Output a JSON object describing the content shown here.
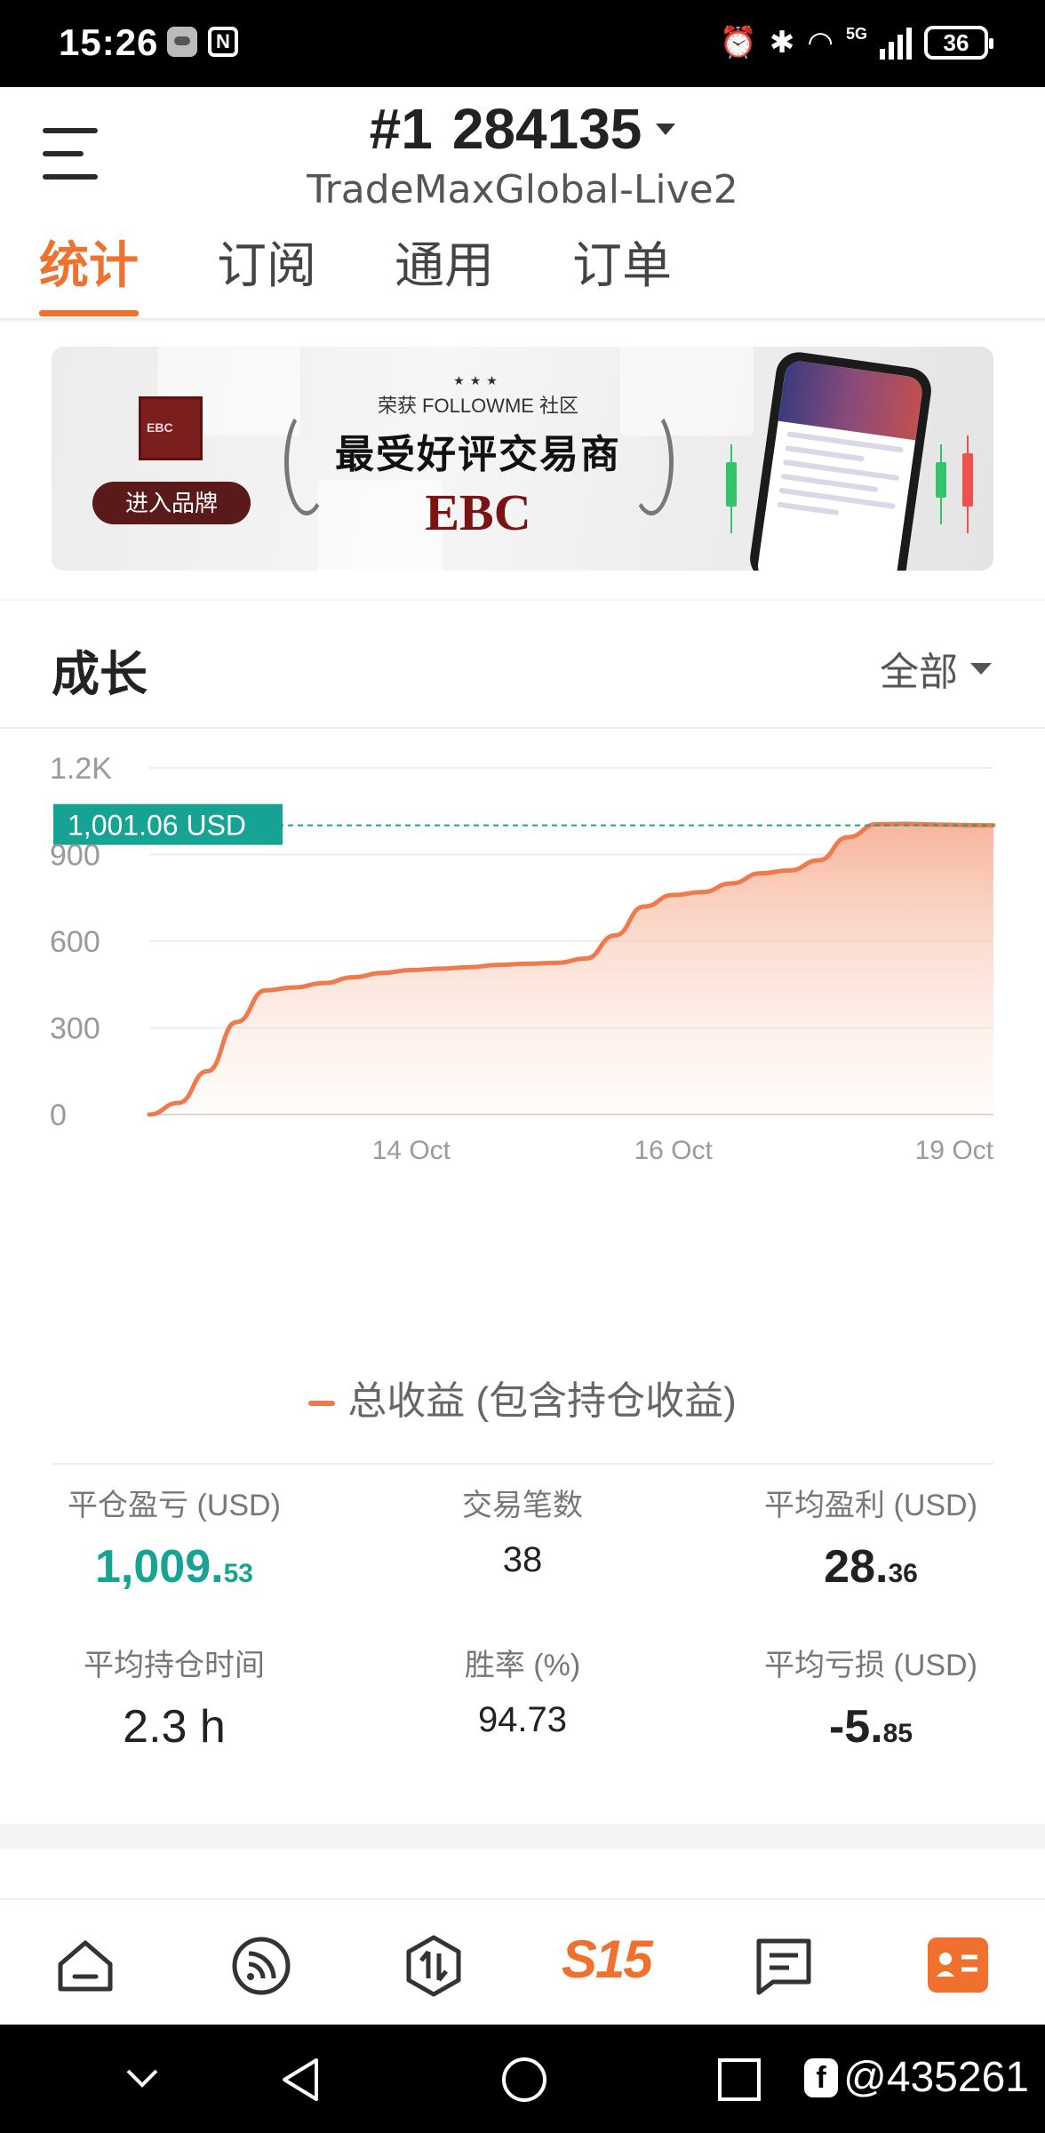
{
  "status_bar": {
    "time": "15:26",
    "network": "5G",
    "battery": "36"
  },
  "header": {
    "account_prefix": "#1",
    "account_number": "284135",
    "server": "TradeMaxGlobal-Live2"
  },
  "tabs": [
    {
      "label": "统计",
      "active": true
    },
    {
      "label": "订阅",
      "active": false
    },
    {
      "label": "通用",
      "active": false
    },
    {
      "label": "订单",
      "active": false
    }
  ],
  "banner": {
    "button_label": "进入品牌",
    "award_subtitle": "荣获 FOLLOWME 社区",
    "award_title": "最受好评交易商",
    "brand": "EBC"
  },
  "growth": {
    "title": "成长",
    "filter": "全部",
    "legend": "总收益 (包含持仓收益)",
    "current_label": "1,001.06 USD",
    "colors": {
      "line": "#ef7a4e",
      "fill": "#f7b9a0",
      "marker": "#16a394"
    }
  },
  "chart_data": {
    "type": "area",
    "ylim": [
      0,
      1200
    ],
    "yticks": [
      "0",
      "300",
      "600",
      "900",
      "1.2K"
    ],
    "xticks": [
      "14 Oct",
      "16 Oct",
      "19 Oct"
    ],
    "current_value": 1001.06,
    "series": [
      {
        "name": "总收益 (包含持仓收益)",
        "values": [
          0,
          40,
          150,
          320,
          430,
          440,
          455,
          475,
          490,
          500,
          505,
          510,
          518,
          522,
          525,
          540,
          620,
          720,
          760,
          770,
          800,
          835,
          845,
          880,
          960,
          1005,
          1006,
          1004,
          1002,
          1001.06
        ]
      }
    ],
    "grid": true
  },
  "stats": [
    {
      "label": "平仓盈亏 (USD)",
      "int": "1,009.",
      "dec": "53",
      "style": "green"
    },
    {
      "label": "交易笔数",
      "int": "38",
      "dec": "",
      "style": "plain"
    },
    {
      "label": "平均盈利 (USD)",
      "int": "28.",
      "dec": "36",
      "style": ""
    },
    {
      "label": "平均持仓时间",
      "int": "2.3 h",
      "dec": "",
      "style": ""
    },
    {
      "label": "胜率 (%)",
      "int": "94.73",
      "dec": "",
      "style": "plain"
    },
    {
      "label": "平均亏损 (USD)",
      "int": "-5.",
      "dec": "85",
      "style": ""
    }
  ],
  "bottom_nav": {
    "s15_label": "S15"
  },
  "watermark": "@435261"
}
